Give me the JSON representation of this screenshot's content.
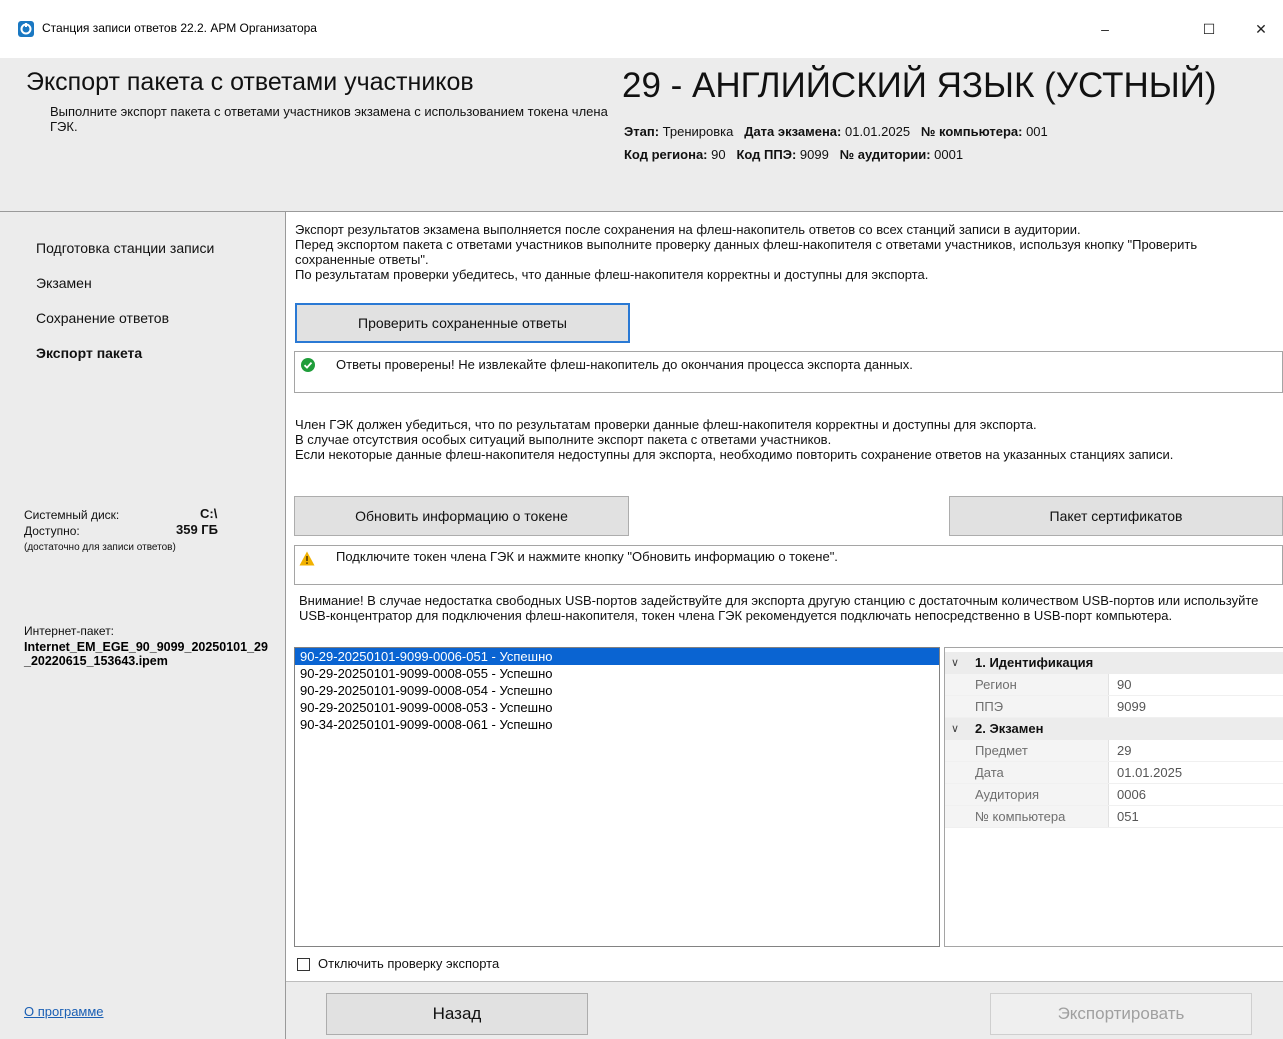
{
  "window": {
    "title": "Станция записи ответов 22.2. АРМ Организатора",
    "minimize_glyph": "–",
    "maximize_glyph": "☐",
    "close_glyph": "✕"
  },
  "header": {
    "title": "Экспорт пакета с ответами участников",
    "subtitle": "Выполните экспорт пакета с ответами участников экзамена с использованием токена члена ГЭК.",
    "subject": "29 - АНГЛИЙСКИЙ ЯЗЫК (УСТНЫЙ)",
    "stage_label": "Этап:",
    "stage_value": "Тренировка",
    "exam_date_label": "Дата экзамена:",
    "exam_date_value": "01.01.2025",
    "computer_label": "№ компьютера:",
    "computer_value": "001",
    "region_label": "Код региона:",
    "region_value": "90",
    "ppe_label": "Код ППЭ:",
    "ppe_value": "9099",
    "room_label": "№ аудитории:",
    "room_value": "0001"
  },
  "sidebar": {
    "items": [
      {
        "label": "Подготовка станции записи",
        "active": false
      },
      {
        "label": "Экзамен",
        "active": false
      },
      {
        "label": "Сохранение ответов",
        "active": false
      },
      {
        "label": "Экспорт пакета",
        "active": true
      }
    ],
    "system_disk_label": "Системный диск:",
    "system_disk_value": "C:\\",
    "available_label": "Доступно:",
    "available_value": "359 ГБ",
    "enough_note": "(достаточно для записи ответов)",
    "internet_package_label": "Интернет-пакет:",
    "internet_package_value": "Internet_EM_EGE_90_9099_20250101_29_20220615_153643.ipem",
    "about_link": "О программе"
  },
  "main": {
    "intro_lines": [
      "Экспорт результатов экзамена выполняется после сохранения на флеш-накопитель ответов со всех станций записи в аудитории.",
      "Перед экспортом пакета с ответами участников выполните проверку данных флеш-накопителя с ответами участников, используя кнопку \"Проверить сохраненные ответы\".",
      "По результатам проверки убедитесь, что данные флеш-накопителя корректны и доступны для экспорта."
    ],
    "check_button": "Проверить сохраненные ответы",
    "check_message": "Ответы проверены! Не извлекайте флеш-накопитель до окончания процесса экспорта данных.",
    "gek_lines": [
      "Член ГЭК должен убедиться, что по результатам проверки данные флеш-накопителя корректны и доступны для экспорта.",
      "В случае отсутствия особых ситуаций выполните экспорт пакета с ответами участников.",
      "Если некоторые данные флеш-накопителя недоступны для экспорта, необходимо повторить сохранение ответов на указанных станциях записи."
    ],
    "refresh_token_button": "Обновить информацию о токене",
    "certificates_button": "Пакет сертификатов",
    "token_message": "Подключите токен члена ГЭК и нажмите кнопку \"Обновить информацию о токене\".",
    "warning_text": "Внимание! В случае недостатка свободных USB-портов задействуйте для экспорта другую станцию с достаточным количеством USB-портов или используйте USB-концентратор для подключения флеш-накопителя, токен члена ГЭК рекомендуется подключать непосредственно в USB-порт компьютера.",
    "files": [
      {
        "name": "90-29-20250101-9099-0006-051 - Успешно",
        "selected": true
      },
      {
        "name": "90-29-20250101-9099-0008-055 - Успешно",
        "selected": false
      },
      {
        "name": "90-29-20250101-9099-0008-054 - Успешно",
        "selected": false
      },
      {
        "name": "90-29-20250101-9099-0008-053 - Успешно",
        "selected": false
      },
      {
        "name": "90-34-20250101-9099-0008-061 - Успешно",
        "selected": false
      }
    ],
    "properties": {
      "cat1": "1. Идентификация",
      "region_label": "Регион",
      "region_value": "90",
      "ppe_label": "ППЭ",
      "ppe_value": "9099",
      "cat2": "2. Экзамен",
      "subject_label": "Предмет",
      "subject_value": "29",
      "date_label": "Дата",
      "date_value": "01.01.2025",
      "room_label": "Аудитория",
      "room_value": "0006",
      "computer_label": "№ компьютера",
      "computer_value": "051"
    },
    "disable_check_label": "Отключить проверку экспорта",
    "disable_check_checked": false
  },
  "footer": {
    "back_button": "Назад",
    "export_button": "Экспортировать",
    "export_enabled": false
  },
  "colors": {
    "selection": "#0a64d2",
    "focus_border": "#2a79d4",
    "success": "#1f9d3a",
    "warning": "#f2b200",
    "panel_bg": "#ececec",
    "link": "#1a5fb4"
  },
  "icons": {
    "app": "app-icon",
    "success": "check-circle-icon",
    "warning": "warning-triangle-icon",
    "expand": "chevron-down-icon"
  }
}
